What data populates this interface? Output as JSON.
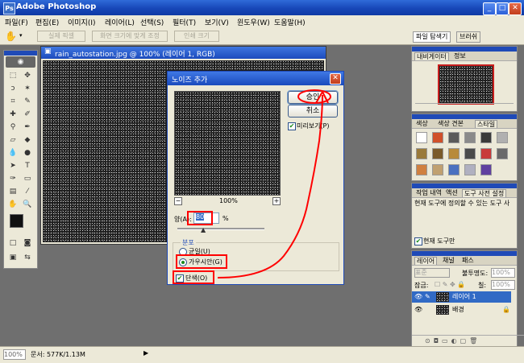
{
  "app": {
    "title": "Adobe Photoshop"
  },
  "menu": [
    "파일(F)",
    "편집(E)",
    "이미지(I)",
    "레이어(L)",
    "선택(S)",
    "필터(T)",
    "보기(V)",
    "윈도우(W)",
    "도움말(H)"
  ],
  "options": {
    "buttons": [
      "실제 픽셀",
      "화면 크기에 맞게 조정",
      "인쇄 크기"
    ],
    "right_tabs": [
      "파일 탐색기",
      "브러쉬"
    ]
  },
  "document": {
    "title": "rain_autostation.jpg @ 100% (레이어 1, RGB)"
  },
  "dialog": {
    "title": "노이즈 추가",
    "ok_label": "승인",
    "cancel_label": "취소",
    "preview_label": "미리보기(P)",
    "zoom": "100%",
    "amount_label": "양(A):",
    "amount_value": "80",
    "amount_unit": "%",
    "distribution_label": "분포",
    "uniform_label": "균일(U)",
    "gaussian_label": "가우시안(G)",
    "mono_label": "단색(O)"
  },
  "panels": {
    "navigator": {
      "tabs": [
        "내비게이터",
        "정보"
      ]
    },
    "styles": {
      "tabs": [
        "색상",
        "색상 견본",
        "스타일"
      ]
    },
    "history": {
      "tabs": [
        "작업 내역",
        "액션",
        "도구 사전 설정"
      ],
      "text": "현재 도구에 정의할 수 있는 도구 사",
      "current_tool_label": "현재 도구만"
    },
    "layers": {
      "tabs": [
        "레이어",
        "채널",
        "패스"
      ],
      "blend": "표준",
      "opacity_label": "불투명도:",
      "opacity": "100%",
      "lock_label": "잠금:",
      "fill_label": "칠:",
      "fill": "100%",
      "items": [
        "레이어 1",
        "배경"
      ]
    }
  },
  "status": {
    "zoom": "100%",
    "doc": "문서: 577K/1.13M"
  },
  "colors": {
    "accent_red": "#ff0000",
    "title_blue": "#1a4abd"
  }
}
